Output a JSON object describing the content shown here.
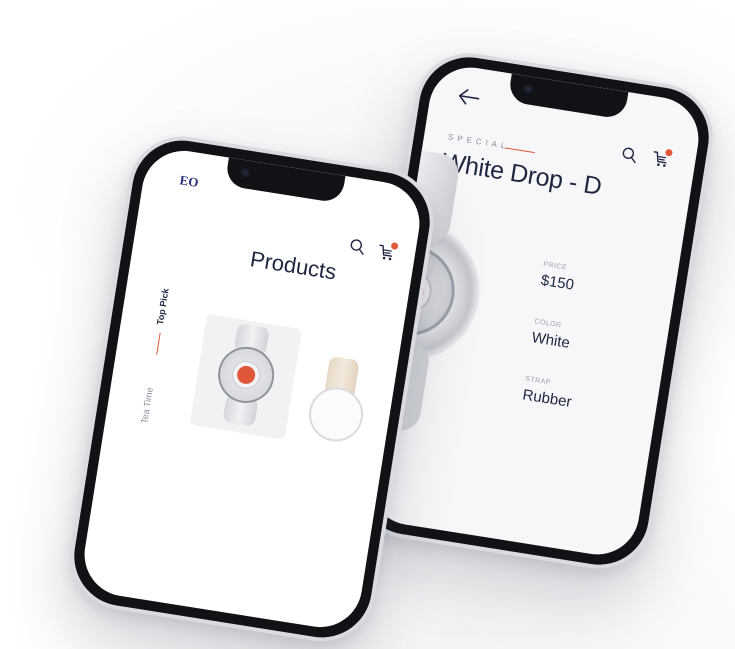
{
  "detail_screen": {
    "label": "SPECIAL",
    "title": "White Drop - D",
    "specs": [
      {
        "key": "PRICE",
        "value": "$150"
      },
      {
        "key": "COLOR",
        "value": "White"
      },
      {
        "key": "STRAP",
        "value": "Rubber"
      }
    ],
    "icons": [
      "back-arrow-icon",
      "search-icon",
      "cart-icon"
    ]
  },
  "products_screen": {
    "logo": "EO",
    "title": "Products",
    "tabs": [
      "Top Pick",
      "Tea Time"
    ],
    "icons": [
      "search-icon",
      "cart-icon"
    ]
  },
  "colors": {
    "accent": "#e0573a",
    "text": "#1f2740",
    "logo": "#27307a"
  }
}
